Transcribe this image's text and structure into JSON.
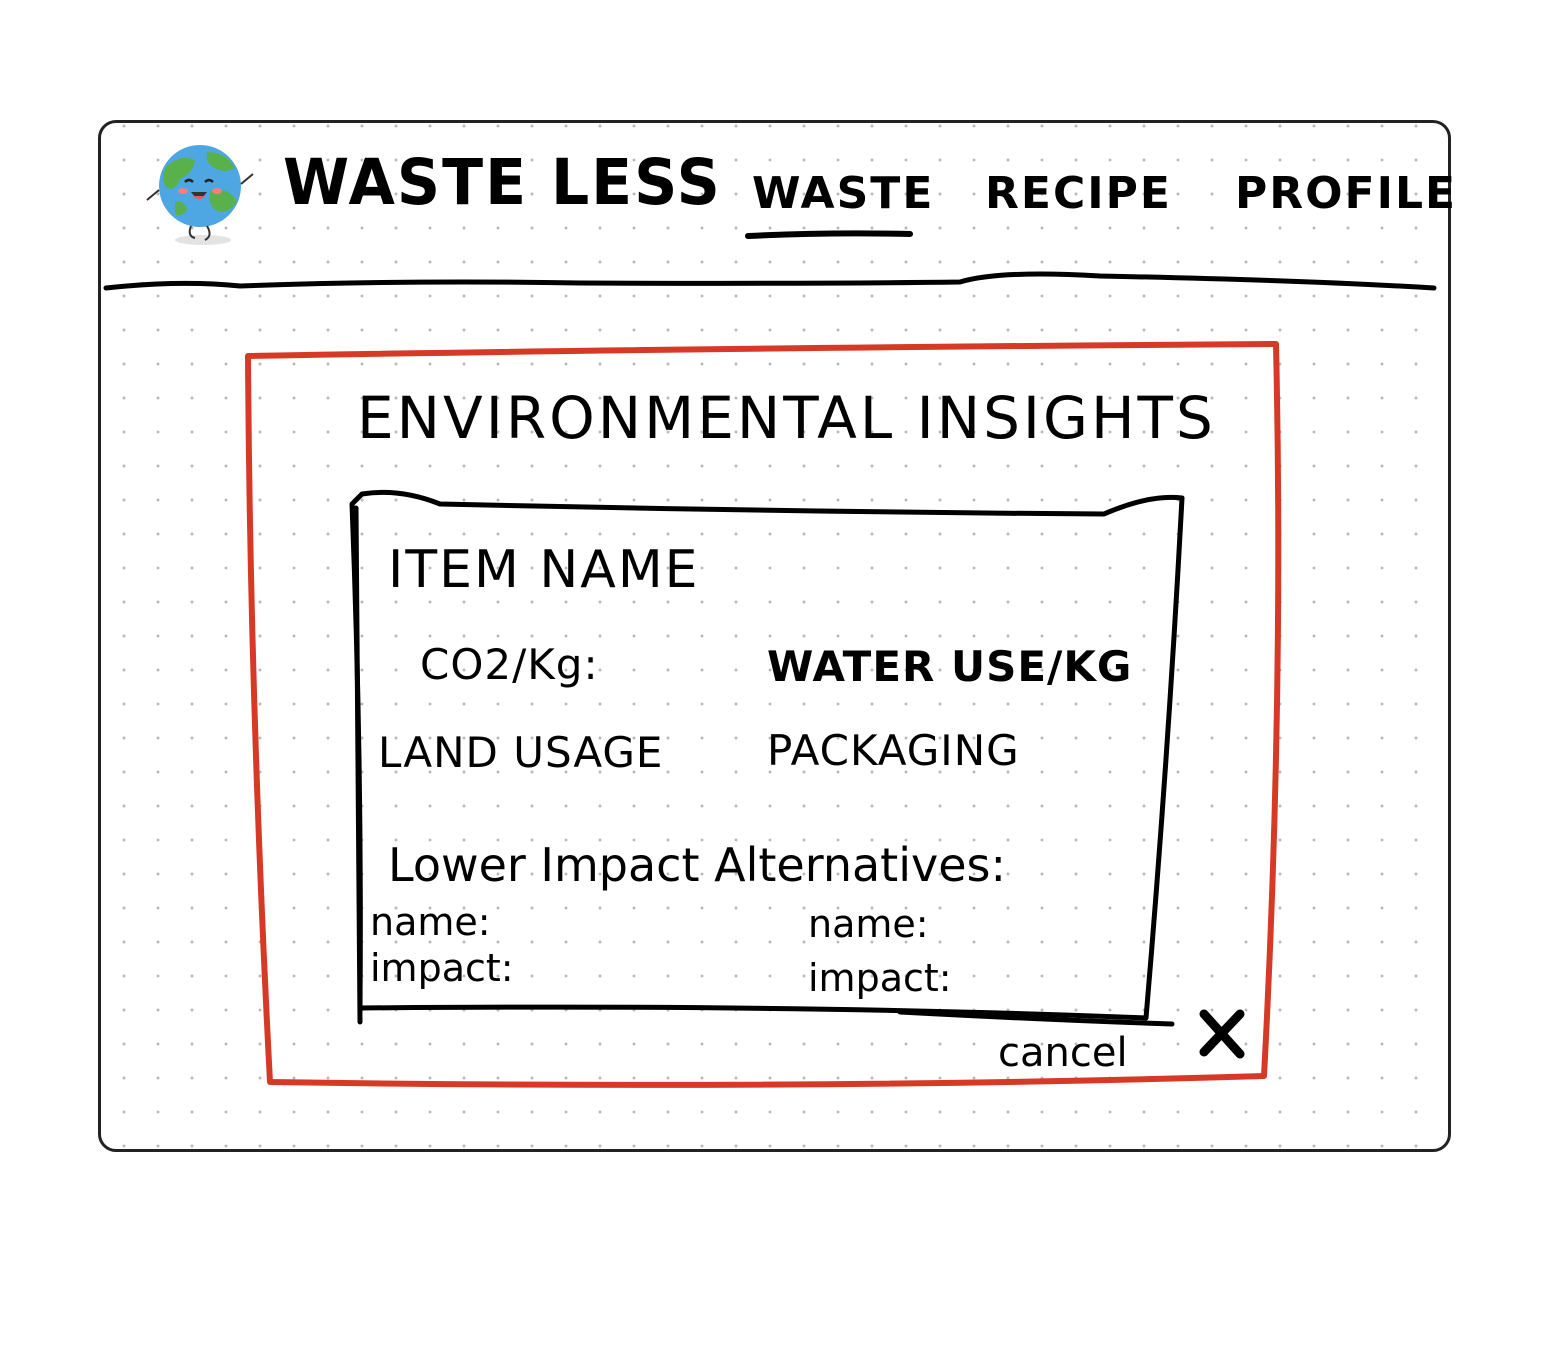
{
  "app": {
    "title": "WASTE LESS"
  },
  "nav": {
    "items": [
      {
        "label": "WASTE",
        "active": true
      },
      {
        "label": "RECIPE",
        "active": false
      },
      {
        "label": "PROFILE",
        "active": false
      }
    ]
  },
  "modal": {
    "title": "ENVIRONMENTAL INSIGHTS",
    "item_name": "ITEM NAME",
    "fields": {
      "co2": "CO2/Kg:",
      "water": "WATER USE/KG",
      "land": "LAND USAGE",
      "packaging": "PACKAGING"
    },
    "alternatives_heading": "Lower Impact Alternatives:",
    "alternatives": [
      {
        "name_label": "name:",
        "impact_label": "impact:"
      },
      {
        "name_label": "name:",
        "impact_label": "impact:"
      }
    ],
    "cancel_label": "cancel",
    "close_icon": "close-icon"
  },
  "colors": {
    "modal_border": "#d63a26",
    "ink": "#000000",
    "dot_grid": "#b9b9b9"
  },
  "icons": {
    "logo": "earth-mascot-icon"
  }
}
